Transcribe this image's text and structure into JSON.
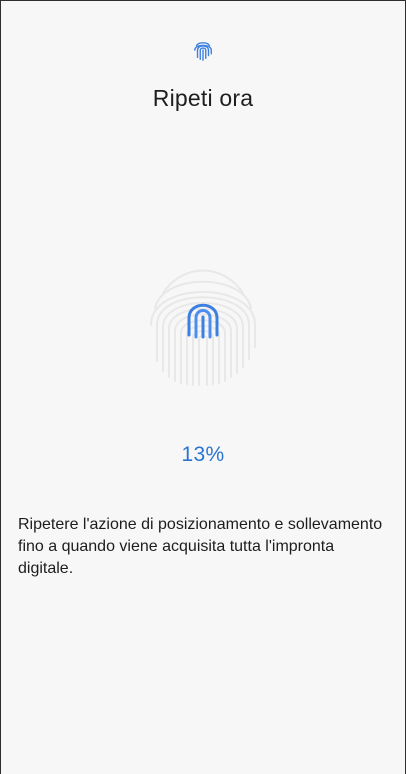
{
  "screen": {
    "title": "Ripeti ora",
    "progress_text": "13%",
    "progress_value": 13,
    "instruction": "Ripetere l'azione di posizionamento e sollevamento fino a quando viene acquisita tutta l'impronta digitale."
  },
  "icons": {
    "top": "fingerprint-icon",
    "sensor": "fingerprint-sensor-icon"
  },
  "colors": {
    "accent": "#2a74d1",
    "icon_blue": "#3d7fe0",
    "background": "#f7f7f7"
  }
}
